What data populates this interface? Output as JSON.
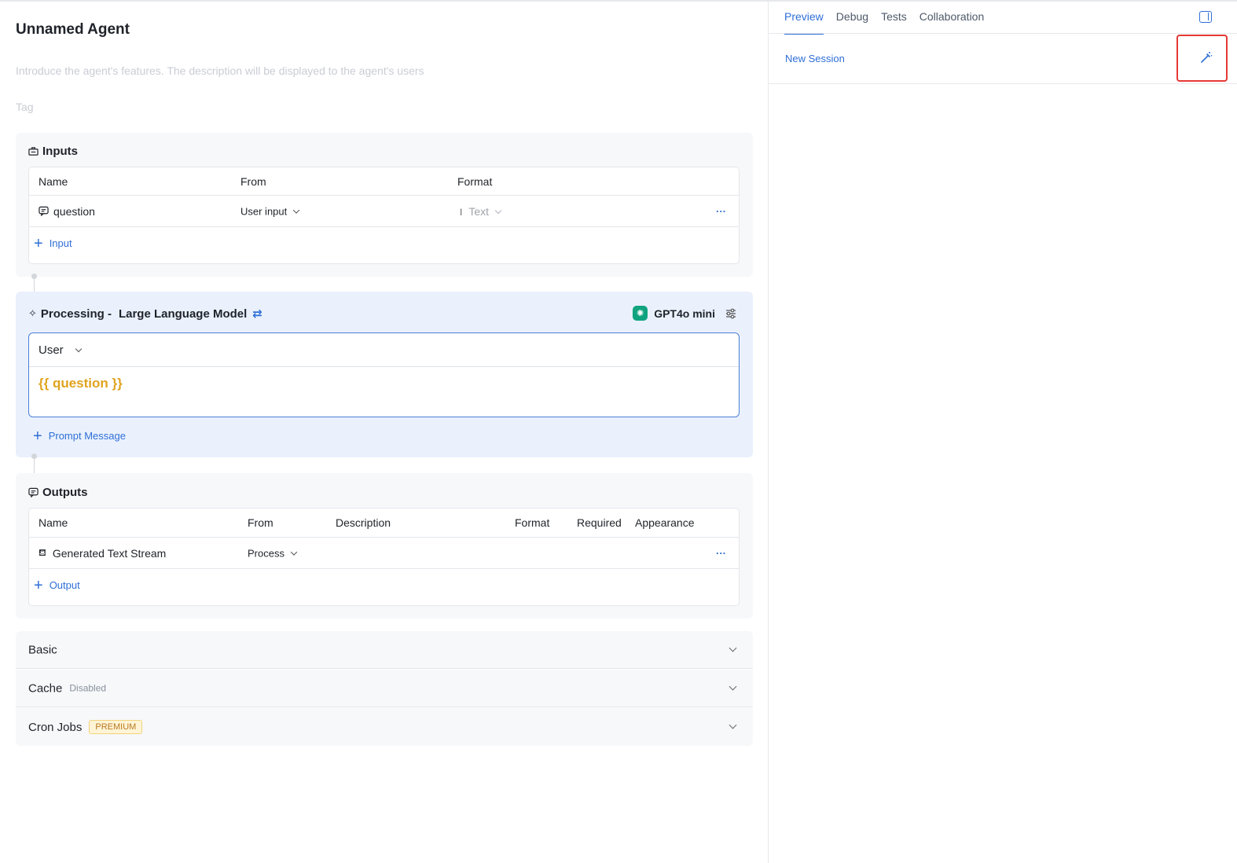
{
  "agent": {
    "title": "Unnamed Agent",
    "description_placeholder": "Introduce the agent's features. The description will be displayed to the agent's users",
    "tag_placeholder": "Tag"
  },
  "inputs": {
    "header": "Inputs",
    "columns": [
      "Name",
      "From",
      "Format"
    ],
    "rows": [
      {
        "name": "question",
        "from": "User input",
        "format": "Text"
      }
    ],
    "add_label": "Input"
  },
  "processing": {
    "prefix": "Processing -",
    "title": "Large Language Model",
    "model": "GPT4o mini",
    "role": "User",
    "prompt": "{{ question }}",
    "add_label": "Prompt Message"
  },
  "outputs": {
    "header": "Outputs",
    "columns": [
      "Name",
      "From",
      "Description",
      "Format",
      "Required",
      "Appearance"
    ],
    "rows": [
      {
        "name": "Generated Text Stream",
        "from": "Process"
      }
    ],
    "add_label": "Output"
  },
  "sections": {
    "basic": "Basic",
    "cache": "Cache",
    "cache_status": "Disabled",
    "cron": "Cron Jobs",
    "cron_badge": "PREMIUM"
  },
  "right_panel": {
    "tabs": [
      "Preview",
      "Debug",
      "Tests",
      "Collaboration"
    ],
    "active_tab": "Preview",
    "new_session": "New Session"
  },
  "colors": {
    "accent": "#2f6fd6",
    "variable": "#e0a31e",
    "highlight_box": "#e53935",
    "model_brand": "#10a37f"
  }
}
